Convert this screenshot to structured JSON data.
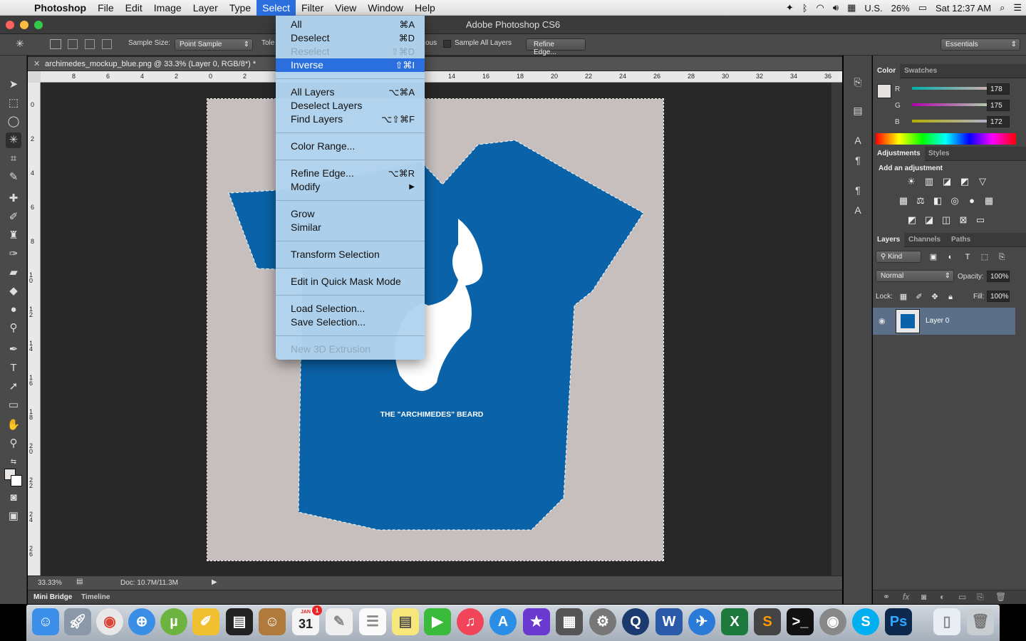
{
  "menubar": {
    "app_name": "Photoshop",
    "items": [
      "File",
      "Edit",
      "Image",
      "Layer",
      "Type",
      "Select",
      "Filter",
      "View",
      "Window",
      "Help"
    ],
    "active_item": "Select",
    "locale": "U.S.",
    "battery": "26%",
    "clock": "Sat 12:37 AM"
  },
  "window": {
    "title": "Adobe Photoshop CS6"
  },
  "options_bar": {
    "sample_size_label": "Sample Size:",
    "sample_size_value": "Point Sample",
    "tolerance_label": "Tole",
    "contiguous_label": "ous",
    "sample_all_layers_label": "Sample All Layers",
    "refine_edge_label": "Refine Edge...",
    "workspace_value": "Essentials"
  },
  "document": {
    "tab_title": "archimedes_mockup_blue.png @ 33.3% (Layer 0, RGB/8*) *",
    "ruler_h_ticks": [
      "8",
      "6",
      "4",
      "2",
      "0",
      "2",
      "14",
      "16",
      "18",
      "20",
      "22",
      "24",
      "26",
      "28",
      "30",
      "32",
      "34",
      "36"
    ],
    "ruler_v_ticks": [
      "0",
      "2",
      "4",
      "6",
      "8",
      "10",
      "12",
      "14",
      "16",
      "18",
      "20",
      "22",
      "24",
      "26"
    ],
    "zoom": "33.33%",
    "doc_size": "Doc: 10.7M/11.3M",
    "shirt_caption": "THE \"ARCHIMEDES\" BEARD"
  },
  "bottom_tabs": [
    "Mini Bridge",
    "Timeline"
  ],
  "select_menu": {
    "items": [
      {
        "label": "All",
        "shortcut": "⌘A",
        "enabled": true
      },
      {
        "label": "Deselect",
        "shortcut": "⌘D",
        "enabled": true
      },
      {
        "label": "Reselect",
        "shortcut": "⇧⌘D",
        "enabled": false
      },
      {
        "label": "Inverse",
        "shortcut": "⇧⌘I",
        "enabled": true,
        "highlighted": true
      },
      {
        "label": "All Layers",
        "shortcut": "⌥⌘A",
        "enabled": true
      },
      {
        "label": "Deselect Layers",
        "shortcut": "",
        "enabled": true
      },
      {
        "label": "Find Layers",
        "shortcut": "⌥⇧⌘F",
        "enabled": true
      },
      {
        "label": "Color Range...",
        "shortcut": "",
        "enabled": true
      },
      {
        "label": "Refine Edge...",
        "shortcut": "⌥⌘R",
        "enabled": true
      },
      {
        "label": "Modify",
        "shortcut": "▶",
        "enabled": true
      },
      {
        "label": "Grow",
        "shortcut": "",
        "enabled": true
      },
      {
        "label": "Similar",
        "shortcut": "",
        "enabled": true
      },
      {
        "label": "Transform Selection",
        "shortcut": "",
        "enabled": true
      },
      {
        "label": "Edit in Quick Mask Mode",
        "shortcut": "",
        "enabled": true
      },
      {
        "label": "Load Selection...",
        "shortcut": "",
        "enabled": true
      },
      {
        "label": "Save Selection...",
        "shortcut": "",
        "enabled": true
      },
      {
        "label": "New 3D Extrusion",
        "shortcut": "",
        "enabled": false
      }
    ]
  },
  "color_panel": {
    "tabs": [
      "Color",
      "Swatches"
    ],
    "r_label": "R",
    "g_label": "G",
    "b_label": "B",
    "r": "178",
    "g": "175",
    "b": "172"
  },
  "adjustments_panel": {
    "tabs": [
      "Adjustments",
      "Styles"
    ],
    "heading": "Add an adjustment"
  },
  "layers_panel": {
    "tabs": [
      "Layers",
      "Channels",
      "Paths"
    ],
    "kind_label": "Kind",
    "blend_mode": "Normal",
    "opacity_label": "Opacity:",
    "opacity": "100%",
    "lock_label": "Lock:",
    "fill_label": "Fill:",
    "fill": "100%",
    "layers": [
      {
        "name": "Layer 0",
        "visible": true
      }
    ]
  },
  "colors": {
    "accent": "#2b6fde",
    "shirt": "#0a63a8",
    "canvas_bg": "#c6bfbe",
    "menu_bg": "#b2d4ee"
  },
  "dock": {
    "calendar_month": "JAN",
    "calendar_day": "31",
    "calendar_badge": "1",
    "apps": [
      "finder",
      "launchpad",
      "chrome",
      "safari",
      "utorrent",
      "growl",
      "activity",
      "contacts",
      "calendar",
      "textedit",
      "reminders",
      "notes",
      "facetime",
      "itunes",
      "appstore",
      "imovie",
      "calculator",
      "systemprefs",
      "quicktime",
      "word",
      "outlook",
      "excel",
      "sublime",
      "terminal",
      "mouse",
      "skype",
      "photoshop",
      "documents",
      "trash"
    ]
  }
}
